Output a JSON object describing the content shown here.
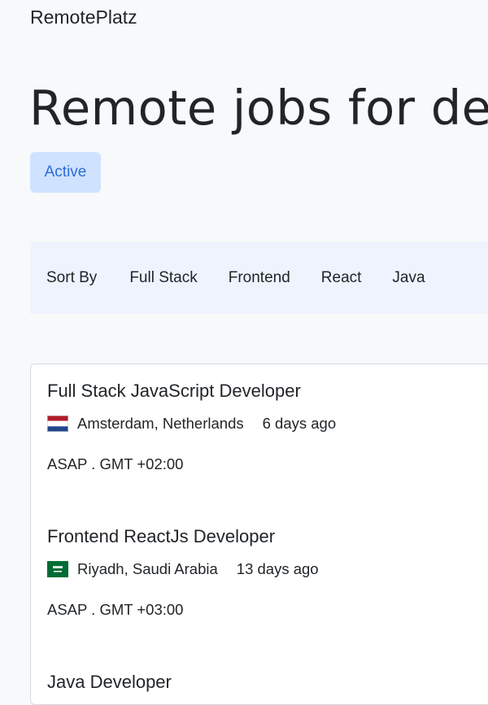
{
  "header": {
    "brand": "RemotePlatz"
  },
  "hero": {
    "title": "Remote jobs for de",
    "status_pill": "Active"
  },
  "filters": {
    "label": "Sort By",
    "items": [
      "Full Stack",
      "Frontend",
      "React",
      "Java"
    ]
  },
  "jobs": [
    {
      "title": "Full Stack JavaScript Developer",
      "flag_icon": "netherlands-flag-icon",
      "location": "Amsterdam, Netherlands",
      "posted": "6 days ago",
      "detail": "ASAP . GMT +02:00"
    },
    {
      "title": "Frontend ReactJs Developer",
      "flag_icon": "saudi-arabia-flag-icon",
      "location": "Riyadh, Saudi Arabia",
      "posted": "13 days ago",
      "detail": "ASAP . GMT +03:00"
    },
    {
      "title": "Java Developer"
    }
  ],
  "colors": {
    "accent": "#2e6dd6",
    "pill_bg": "#cfe2ff",
    "filter_bg": "#eef3fd",
    "page_bg": "#f8f9fa"
  }
}
